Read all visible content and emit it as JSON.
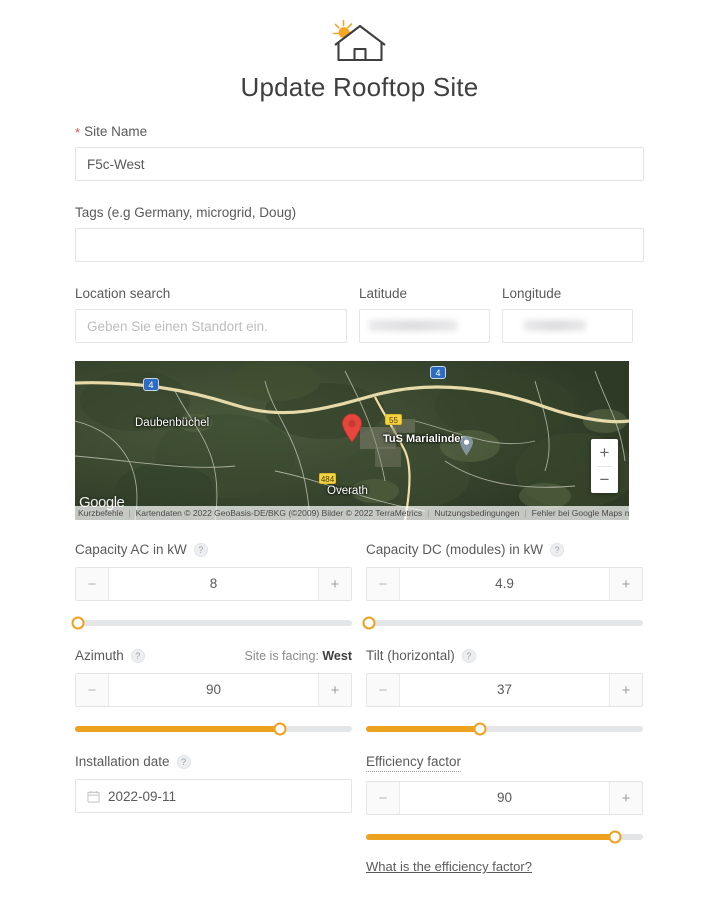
{
  "header": {
    "title": "Update Rooftop Site",
    "logo_icon": "house-with-sun-icon"
  },
  "form": {
    "site_name": {
      "label": "Site Name",
      "required_marker": "*",
      "value": "F5c-West",
      "placeholder": ""
    },
    "tags": {
      "label": "Tags (e.g Germany, microgrid, Doug)",
      "value": "",
      "placeholder": ""
    },
    "location_search": {
      "label": "Location search",
      "value": "",
      "placeholder": "Geben Sie einen Standort ein."
    },
    "latitude": {
      "label": "Latitude",
      "value": "",
      "redacted": true
    },
    "longitude": {
      "label": "Longitude",
      "value": "",
      "redacted": true
    }
  },
  "map": {
    "place_labels": [
      "Daubenbüchel",
      "Overath",
      "TuS Marialinden"
    ],
    "highway_shields": [
      "4",
      "4"
    ],
    "road_shields": [
      "55",
      "484"
    ],
    "zoom_in_label": "+",
    "zoom_out_label": "−",
    "wordmark": "Google",
    "attribution": {
      "shortcuts": "Kurzbefehle",
      "map_data": "Kartendaten © 2022 GeoBasis-DE/BKG (©2009) Bilder © 2022 TerraMetrics",
      "terms": "Nutzungsbedingungen",
      "report": "Fehler bei Google Maps melden"
    },
    "marker_icon": "map-pin-icon",
    "poi_icon": "poi-pin-icon"
  },
  "fields": {
    "capacity_ac": {
      "label": "Capacity AC in kW",
      "help_icon": "question-mark-icon",
      "value": "8",
      "minus_label": "−",
      "plus_label": "+",
      "slider_percent": 1
    },
    "capacity_dc": {
      "label": "Capacity DC (modules) in kW",
      "help_icon": "question-mark-icon",
      "value": "4.9",
      "minus_label": "−",
      "plus_label": "+",
      "slider_percent": 1
    },
    "azimuth": {
      "label": "Azimuth",
      "help_icon": "question-mark-icon",
      "facing_prefix": "Site is facing:",
      "facing_value": "West",
      "value": "90",
      "minus_label": "−",
      "plus_label": "+",
      "slider_percent": 74
    },
    "tilt": {
      "label": "Tilt (horizontal)",
      "help_icon": "question-mark-icon",
      "value": "37",
      "minus_label": "−",
      "plus_label": "+",
      "slider_percent": 41
    },
    "installation_date": {
      "label": "Installation date",
      "help_icon": "question-mark-icon",
      "value": "2022-09-11",
      "calendar_icon": "calendar-icon"
    },
    "efficiency_factor": {
      "label": "Efficiency factor",
      "value": "90",
      "minus_label": "−",
      "plus_label": "+",
      "slider_percent": 90,
      "link_text": "What is the efficiency factor?"
    }
  },
  "colors": {
    "accent": "#eda21f",
    "required": "#d9534f",
    "text": "#595959",
    "border": "#e4e5e7"
  }
}
